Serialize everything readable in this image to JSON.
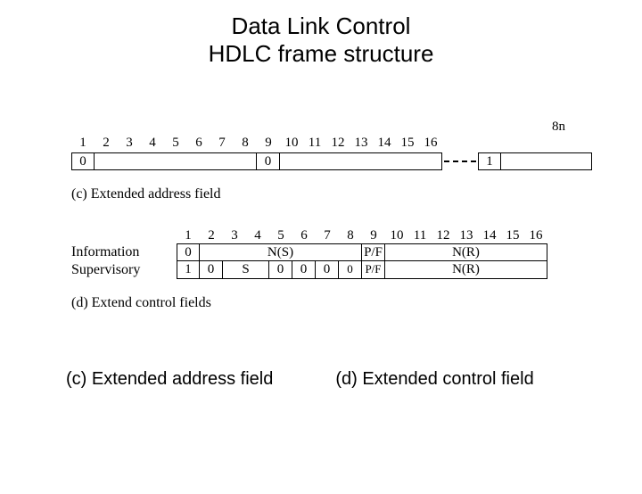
{
  "title_line1": "Data Link Control",
  "title_line2": "HDLC frame structure",
  "addr": {
    "bits": [
      "1",
      "2",
      "3",
      "4",
      "5",
      "6",
      "7",
      "8",
      "9",
      "10",
      "11",
      "12",
      "13",
      "14",
      "15",
      "16"
    ],
    "octet_zero": "0",
    "end_label": "8n",
    "end_one": "1",
    "caption": "(c) Extended address field"
  },
  "ctrl": {
    "bits": [
      "1",
      "2",
      "3",
      "4",
      "5",
      "6",
      "7",
      "8",
      "9",
      "10",
      "11",
      "12",
      "13",
      "14",
      "15",
      "16"
    ],
    "row_info_label": "Information",
    "row_sup_label": "Supervisory",
    "info": {
      "b1": "0",
      "ns": "N(S)",
      "pf": "P/F",
      "nr": "N(R)"
    },
    "sup": {
      "b1": "1",
      "b2": "0",
      "s": "S",
      "z": "0",
      "pf": "P/F",
      "nr": "N(R)"
    },
    "caption": "(d) Extend control fields"
  },
  "footer_c": "(c) Extended address field",
  "footer_d": "(d) Extended control field"
}
